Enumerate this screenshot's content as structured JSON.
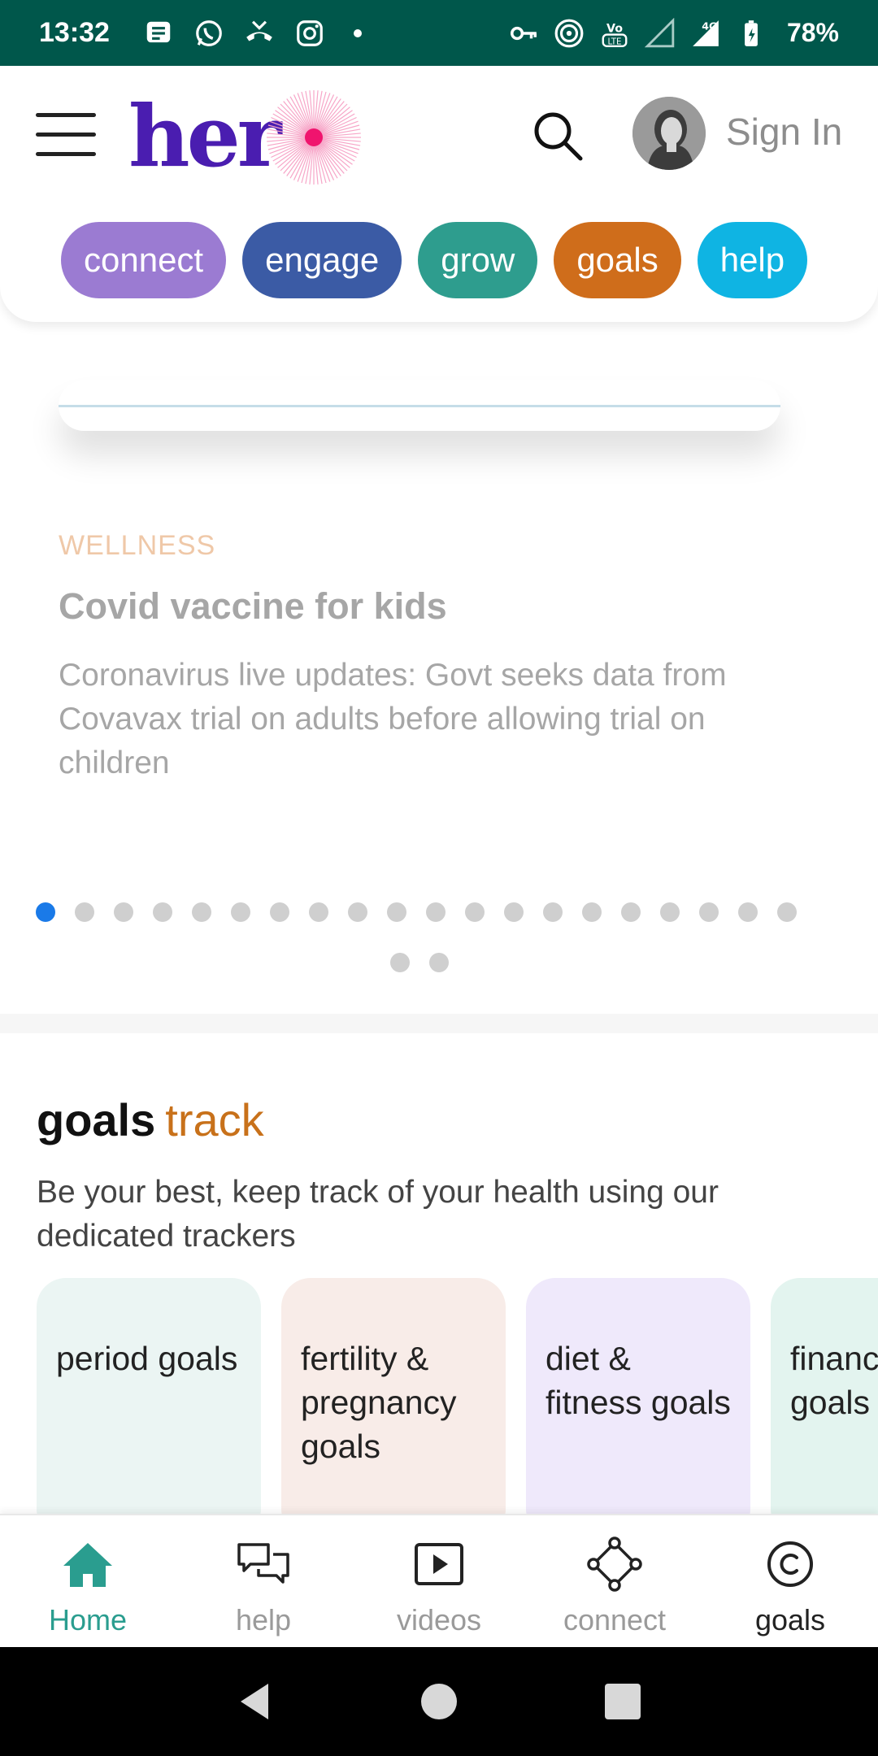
{
  "status_bar": {
    "time": "13:32",
    "battery": "78%",
    "network": "4G",
    "volte": "Vo LTE"
  },
  "header": {
    "logo_text": "her",
    "sign_in": "Sign In",
    "chips": [
      {
        "label": "connect",
        "color": "#9b7bd2"
      },
      {
        "label": "engage",
        "color": "#3b5ba5"
      },
      {
        "label": "grow",
        "color": "#2e9d8e"
      },
      {
        "label": "goals",
        "color": "#cf6d1b"
      },
      {
        "label": "help",
        "color": "#0fb4e3"
      }
    ]
  },
  "carousel": {
    "category": "WELLNESS",
    "title": "Covid vaccine for kids",
    "description": "Coronavirus live updates: Govt seeks data from Covavax trial on adults before allowing trial on children",
    "page_count": 22,
    "active_index": 0
  },
  "goals_section": {
    "title": "goals",
    "title_accent": "track",
    "description": "Be your best, keep track of your health using our dedicated trackers",
    "trackers": [
      {
        "label": "period goals",
        "bg": "#ebf5f3"
      },
      {
        "label": "fertility & pregnancy goals",
        "bg": "#f8ece8"
      },
      {
        "label": "diet & fitness goals",
        "bg": "#efe9fb"
      },
      {
        "label": "finance goals",
        "bg": "#e3f4ef"
      }
    ]
  },
  "bottom_nav": {
    "items": [
      {
        "label": "Home",
        "icon": "home-icon"
      },
      {
        "label": "help",
        "icon": "chat-icon"
      },
      {
        "label": "videos",
        "icon": "play-icon"
      },
      {
        "label": "connect",
        "icon": "connect-icon"
      },
      {
        "label": "goals",
        "icon": "goals-icon"
      }
    ]
  },
  "colors": {
    "status_bar": "#00574b",
    "brand_purple": "#4a1db0",
    "brand_pink": "#f0146e",
    "accent_orange": "#c8711a",
    "active_teal": "#2a9d8f",
    "active_dot": "#1a7ae8"
  }
}
